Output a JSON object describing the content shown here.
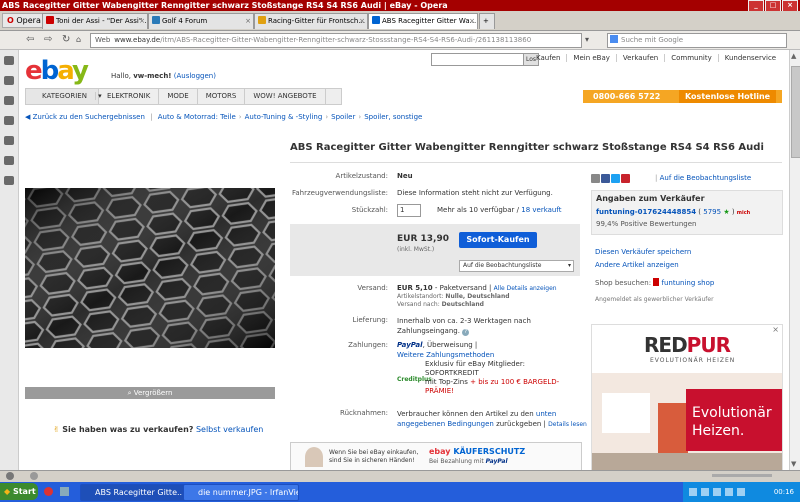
{
  "window": {
    "title": "ABS Racegitter Gitter Wabengitter Renngitter schwarz Stoßstange RS4 S4 RS6 Audi | eBay - Opera"
  },
  "browser": {
    "menu_label": "Opera",
    "tabs": [
      {
        "label": "Toni der Assi - \"Der Assi\" ...",
        "active": false
      },
      {
        "label": "Golf 4 Forum",
        "active": false
      },
      {
        "label": "Racing-Gitter für Frontsch...",
        "active": false
      },
      {
        "label": "ABS Racegitter Gitter Wa...",
        "active": true
      }
    ],
    "web_label": "Web",
    "url_host": "www.ebay.de",
    "url_path": "/itm/ABS-Racegitter-Gitter-Wabengitter-Renngitter-schwarz-Stossstange-RS4-S4-RS6-Audi-/261138113860",
    "search_placeholder": "Suche mit Google"
  },
  "header": {
    "logo_letters": [
      "e",
      "b",
      "a",
      "y"
    ],
    "logo_colors": [
      "#e53238",
      "#0064d2",
      "#f5af02",
      "#86b817"
    ],
    "hello_text": "Hallo,",
    "username": "vw-mech!",
    "logout_link": "(Ausloggen)",
    "search_button": "Los",
    "top_links": [
      "Kaufen",
      "Mein eBay",
      "Verkaufen",
      "Community",
      "Kundenservice"
    ],
    "nav": [
      "KATEGORIEN",
      "ELEKTRONIK",
      "MODE",
      "MOTORS",
      "WOW! ANGEBOTE"
    ],
    "hotline_number": "0800-666 5722",
    "hotline_label": "Kostenlose Hotline"
  },
  "breadcrumb": {
    "back": "Zurück zu den Suchergebnissen",
    "items": [
      "Auto & Motorrad: Teile",
      "Auto-Tuning & -Styling",
      "Spoiler",
      "Spoiler, sonstige"
    ]
  },
  "product": {
    "title": "ABS Racegitter Gitter Wabengitter Renngitter schwarz Stoßstange RS4 S4 RS6 Audi",
    "zoom_label": "Vergrößern",
    "sell_question": "Sie haben was zu verkaufen?",
    "sell_link": "Selbst verkaufen"
  },
  "details": {
    "condition_label": "Artikelzustand:",
    "condition_value": "Neu",
    "compat_label": "Fahrzeugverwendungsliste:",
    "compat_value": "Diese Information steht nicht zur Verfügung.",
    "qty_label": "Stückzahl:",
    "qty_value": "1",
    "qty_avail": "Mehr als 10 verfügbar",
    "qty_sold": "18 verkauft",
    "price": "EUR 13,90",
    "price_incl": "(inkl. MwSt.)",
    "buy_button": "Sofort-Kaufen",
    "watch_select": "Auf die Beobachtungsliste",
    "shipping_label": "Versand:",
    "shipping_value": "EUR 5,10",
    "shipping_type": "- Paketversand",
    "shipping_details_link": "Alle Details anzeigen",
    "location_label": "Artikelstandort:",
    "location_value": "Nulle, Deutschland",
    "ship_to_label": "Versand nach:",
    "ship_to_value": "Deutschland",
    "delivery_label": "Lieferung:",
    "delivery_value": "Innerhalb von ca. 2-3 Werktagen nach Zahlungseingang.",
    "payment_label": "Zahlungen:",
    "payment_paypal": "PayPal",
    "payment_transfer": ", Überweisung |",
    "payment_more_link": "Weitere Zahlungsmethoden",
    "credit_text_1": "Exklusiv für eBay Mitglieder:",
    "credit_text_2": "SOFORTKREDIT",
    "credit_text_3": "mit Top-Zins",
    "credit_text_4": "+ bis zu 100 € BARGELD-PRÄMIE!",
    "credit_logo": "Creditplus",
    "returns_label": "Rücknahmen:",
    "returns_value": "Verbraucher können den Artikel zu den",
    "returns_link": "unten angegebenen Bedingungen",
    "returns_value_2": "zurückgeben |",
    "returns_details": "Details lesen"
  },
  "protection": {
    "text_1": "Wenn Sie bei eBay einkaufen,",
    "text_2": "sind Sie in sicheren Händen!",
    "brand_1": "ebay",
    "brand_2": "KÄUFERSCHUTZ",
    "brand_3": "Bei Bezahlung mit",
    "brand_4": "PayPal"
  },
  "seller": {
    "watch_link": "Auf die Beobachtungsliste",
    "box_title": "Angaben zum Verkäufer",
    "name": "funtuning-017624448854",
    "rating": "5795",
    "badge": "mich",
    "positive": "99,4% Positive Bewertungen",
    "save_seller": "Diesen Verkäufer speichern",
    "other_items": "Andere Artikel anzeigen",
    "shop_label": "Shop besuchen:",
    "shop_name": "funtuning shop",
    "registered": "Angemeldet als gewerblicher Verkäufer"
  },
  "ad": {
    "brand_1": "RED",
    "brand_2": "PUR",
    "tagline": "EVOLUTIONÄR HEIZEN",
    "headline_1": "Evolutionär",
    "headline_2": "Heizen."
  },
  "taskbar": {
    "start": "Start",
    "tasks": [
      {
        "label": "ABS Racegitter Gitte...",
        "active": true
      },
      {
        "label": "die nummer.JPG - IrfanVie...",
        "active": false
      }
    ],
    "time": "00:16"
  }
}
